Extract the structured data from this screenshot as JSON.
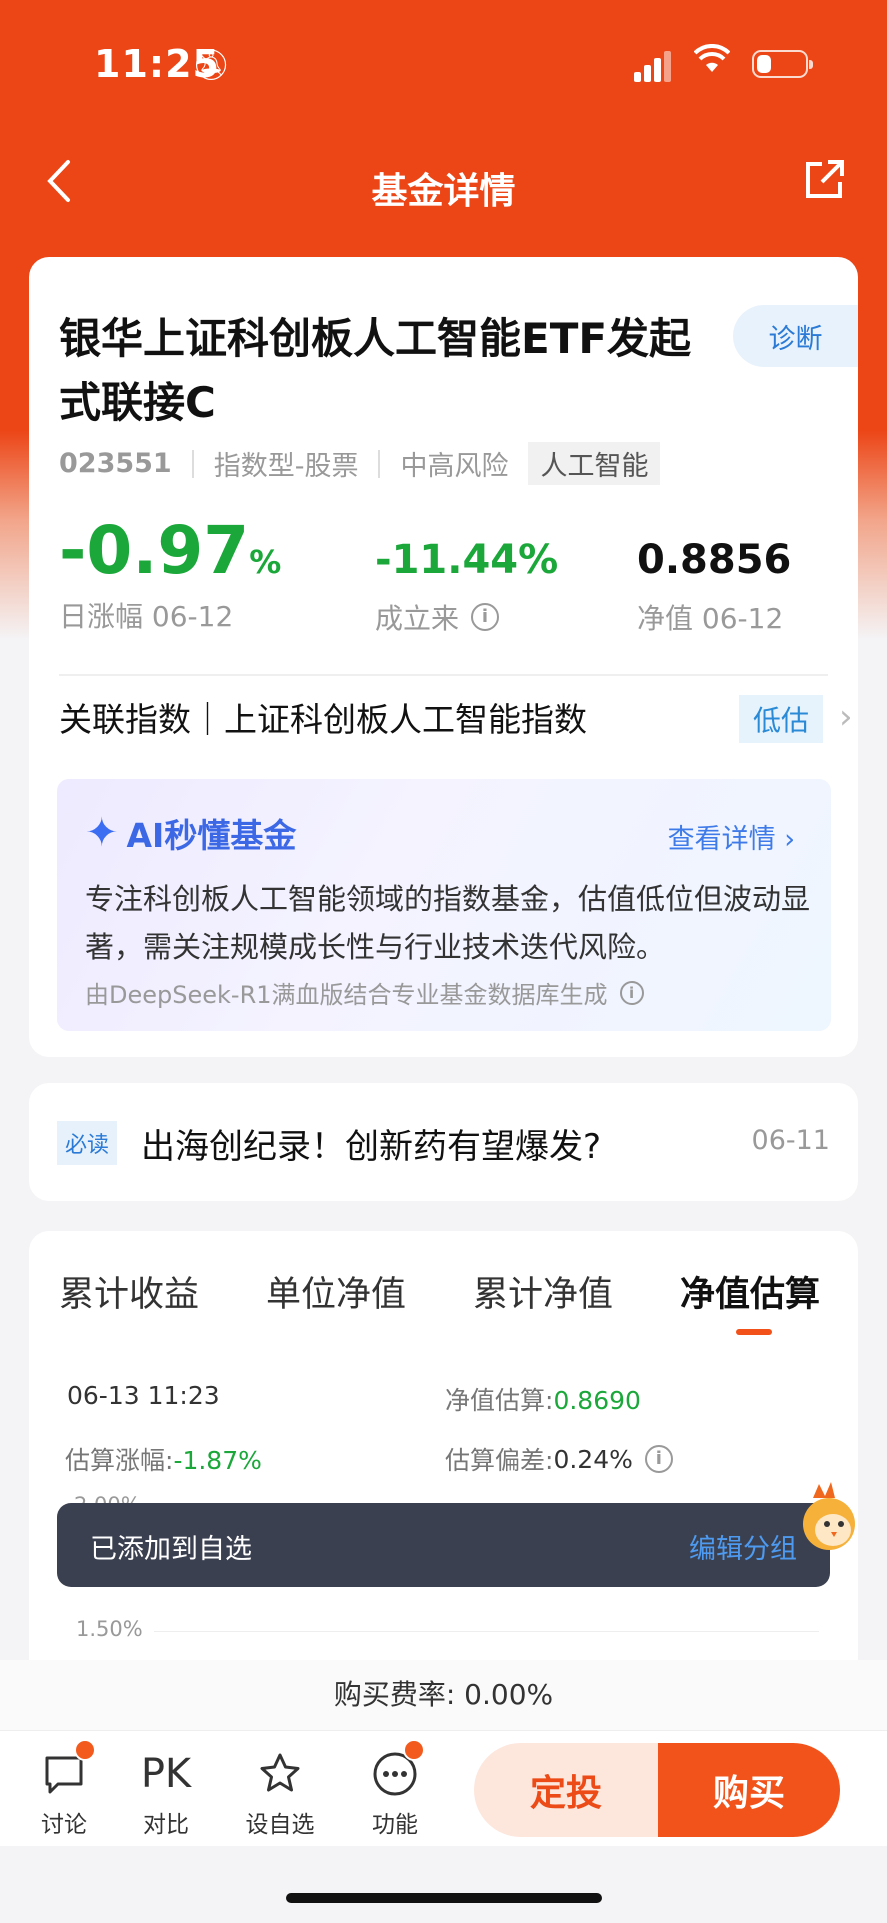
{
  "status": {
    "time": "11:25"
  },
  "nav": {
    "title": "基金详情"
  },
  "fund": {
    "name": "银华上证科创板人工智能ETF发起式联接C",
    "diagnose": "诊断",
    "code": "023551",
    "type": "指数型-股票",
    "risk": "中高风险",
    "tag": "人工智能"
  },
  "stats": {
    "daily": {
      "value": "-0.97",
      "unit": "%",
      "label": "日涨幅 06-12"
    },
    "since": {
      "value": "-11.44%",
      "label": "成立来"
    },
    "nav": {
      "value": "0.8856",
      "label": "净值 06-12"
    }
  },
  "index": {
    "text": "关联指数｜上证科创板人工智能指数",
    "badge": "低估"
  },
  "ai": {
    "title": "AI秒懂基金",
    "more": "查看详情",
    "body": "专注科创板人工智能领域的指数基金，估值低位但波动显著，需关注规模成长性与行业技术迭代风险。",
    "source": "由DeepSeek-R1满血版结合专业基金数据库生成"
  },
  "news": {
    "badge": "必读",
    "headline": "出海创纪录！创新药有望爆发?",
    "date": "06-11"
  },
  "tabs": [
    "累计收益",
    "单位净值",
    "累计净值",
    "净值估算"
  ],
  "estimate": {
    "time": "06-13 11:23",
    "nav_label": "净值估算:",
    "nav_value": "0.8690",
    "chg_label": "估算涨幅:",
    "chg_value": "-1.87%",
    "dev_label": "估算偏差:",
    "dev_value": "0.24%"
  },
  "chart": {
    "y_labels": [
      "2.00%",
      "1.50%"
    ]
  },
  "toast": {
    "message": "已添加到自选",
    "action": "编辑分组"
  },
  "fee": "购买费率: 0.00%",
  "bottom": {
    "discuss": "讨论",
    "pk_icon": "PK",
    "compare": "对比",
    "watch": "设自选",
    "functions": "功能",
    "dingtou": "定投",
    "buy": "购买"
  }
}
